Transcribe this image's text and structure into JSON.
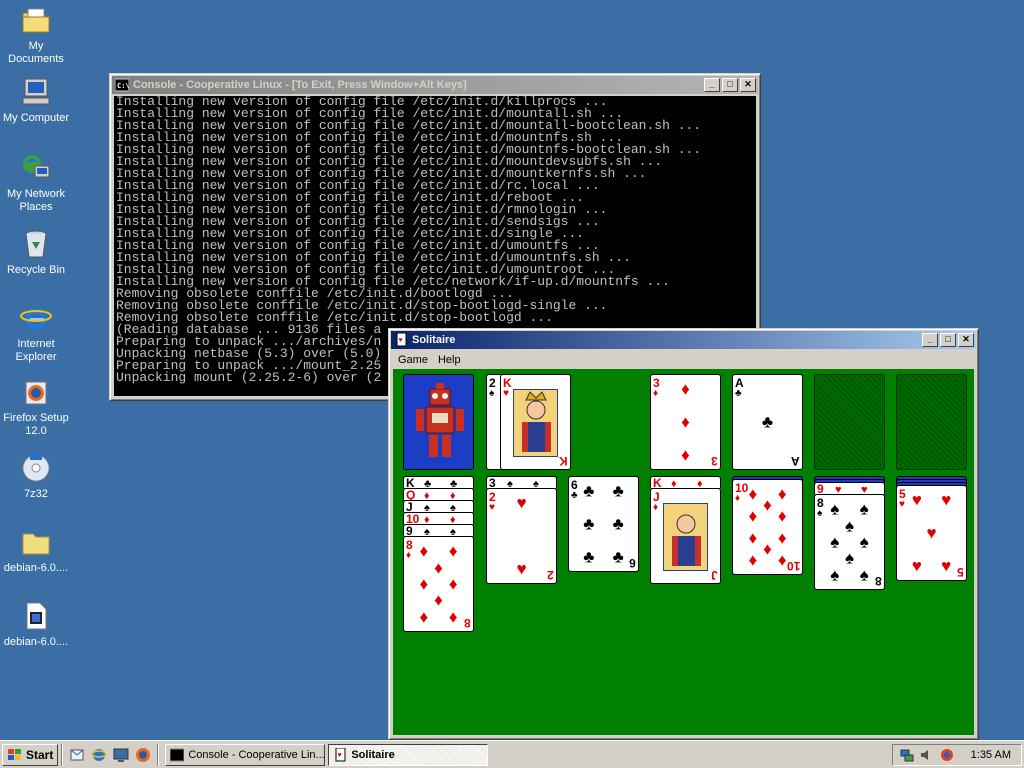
{
  "desktop": {
    "icons": [
      {
        "label": "My Documents"
      },
      {
        "label": "My Computer"
      },
      {
        "label": "My Network Places"
      },
      {
        "label": "Recycle Bin"
      },
      {
        "label": "Internet Explorer"
      },
      {
        "label": "Firefox Setup 12.0"
      },
      {
        "label": "7z32"
      },
      {
        "label": "debian-6.0...."
      },
      {
        "label": "debian-6.0...."
      }
    ]
  },
  "console": {
    "title": "Console - Cooperative Linux - [To Exit, Press Window+Alt Keys]",
    "lines": [
      "Installing new version of config file /etc/init.d/killprocs ...",
      "Installing new version of config file /etc/init.d/mountall.sh ...",
      "Installing new version of config file /etc/init.d/mountall-bootclean.sh ...",
      "Installing new version of config file /etc/init.d/mountnfs.sh ...",
      "Installing new version of config file /etc/init.d/mountnfs-bootclean.sh ...",
      "Installing new version of config file /etc/init.d/mountdevsubfs.sh ...",
      "Installing new version of config file /etc/init.d/mountkernfs.sh ...",
      "Installing new version of config file /etc/init.d/rc.local ...",
      "Installing new version of config file /etc/init.d/reboot ...",
      "Installing new version of config file /etc/init.d/rmnologin ...",
      "Installing new version of config file /etc/init.d/sendsigs ...",
      "Installing new version of config file /etc/init.d/single ...",
      "Installing new version of config file /etc/init.d/umountfs ...",
      "Installing new version of config file /etc/init.d/umountnfs.sh ...",
      "Installing new version of config file /etc/init.d/umountroot ...",
      "Installing new version of config file /etc/network/if-up.d/mountnfs ...",
      "Removing obsolete conffile /etc/init.d/bootlogd ...",
      "Removing obsolete conffile /etc/init.d/stop-bootlogd-single ...",
      "Removing obsolete conffile /etc/init.d/stop-bootlogd ...",
      "(Reading database ... 9136 files a",
      "Preparing to unpack .../archives/n",
      "Unpacking netbase (5.3) over (5.0)",
      "Preparing to unpack .../mount_2.25",
      "Unpacking mount (2.25.2-6) over (2"
    ]
  },
  "solitaire": {
    "title": "Solitaire",
    "menu": [
      "Game",
      "Help"
    ],
    "waste_top": {
      "rank": "K",
      "suit": "♥",
      "under_rank": "2",
      "under_suit": "♠"
    },
    "foundations": [
      {
        "rank": "3",
        "suit": "♦",
        "color": "red"
      },
      {
        "rank": "A",
        "suit": "♣",
        "color": "black"
      }
    ],
    "tableau": [
      {
        "stubs": [
          {
            "rank": "K",
            "suit": "♣",
            "color": "black"
          },
          {
            "rank": "Q",
            "suit": "♦",
            "color": "red"
          },
          {
            "rank": "J",
            "suit": "♠",
            "color": "black"
          },
          {
            "rank": "10",
            "suit": "♦",
            "color": "red"
          },
          {
            "rank": "9",
            "suit": "♠",
            "color": "black"
          }
        ],
        "top": {
          "rank": "8",
          "suit": "♦",
          "color": "red"
        }
      },
      {
        "stubs": [
          {
            "rank": "3",
            "suit": "♠",
            "color": "black"
          }
        ],
        "top": {
          "rank": "2",
          "suit": "♥",
          "color": "red"
        }
      },
      {
        "stubs": [],
        "top": {
          "rank": "6",
          "suit": "♣",
          "color": "black"
        }
      },
      {
        "stubs": [
          {
            "rank": "K",
            "suit": "♦",
            "color": "red"
          }
        ],
        "top": {
          "rank": "J",
          "suit": "♦",
          "color": "red"
        }
      },
      {
        "stubs": [],
        "top": {
          "rank": "10",
          "suit": "♦",
          "color": "red"
        }
      },
      {
        "stubs": [
          {
            "rank": "9",
            "suit": "♥",
            "color": "red"
          }
        ],
        "top": {
          "rank": "8",
          "suit": "♠",
          "color": "black"
        }
      },
      {
        "stubs": [],
        "top": {
          "rank": "5",
          "suit": "♥",
          "color": "red"
        }
      }
    ]
  },
  "taskbar": {
    "start_label": "Start",
    "tasks": [
      {
        "label": "Console - Cooperative Lin..."
      },
      {
        "label": "Solitaire"
      }
    ],
    "clock": "1:35 AM"
  },
  "colors": {
    "desktop": "#3a6ea5",
    "felt": "#008000",
    "title_active": "#0a246a"
  }
}
